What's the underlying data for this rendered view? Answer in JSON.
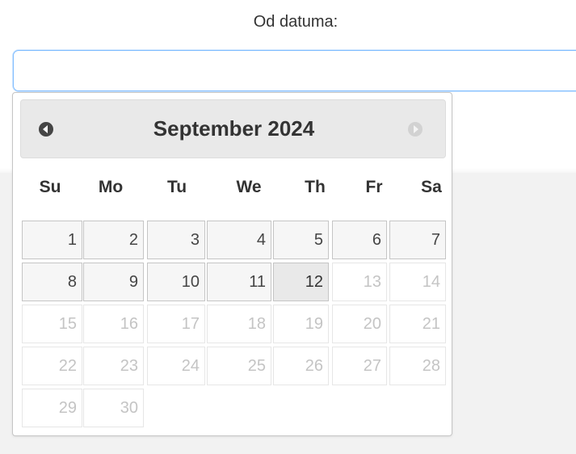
{
  "form": {
    "label": "Od datuma:",
    "input_value": ""
  },
  "datepicker": {
    "title": "September 2024",
    "prev_icon": "chevron-left-circle-icon",
    "next_icon": "chevron-right-circle-icon",
    "weekdays": [
      "Su",
      "Mo",
      "Tu",
      "We",
      "Th",
      "Fr",
      "Sa"
    ],
    "weeks": [
      [
        "1",
        "2",
        "3",
        "4",
        "5",
        "6",
        "7"
      ],
      [
        "8",
        "9",
        "10",
        "11",
        "12",
        "13",
        "14"
      ],
      [
        "15",
        "16",
        "17",
        "18",
        "19",
        "20",
        "21"
      ],
      [
        "22",
        "23",
        "24",
        "25",
        "26",
        "27",
        "28"
      ],
      [
        "29",
        "30"
      ]
    ]
  },
  "colors": {
    "input_focus_border": "#80bdff",
    "cell_bg": "#f6f6f6",
    "cell_border": "#c5c5c5",
    "disabled_text": "#c4c4c4",
    "header_bg": "#e9e9e9"
  }
}
